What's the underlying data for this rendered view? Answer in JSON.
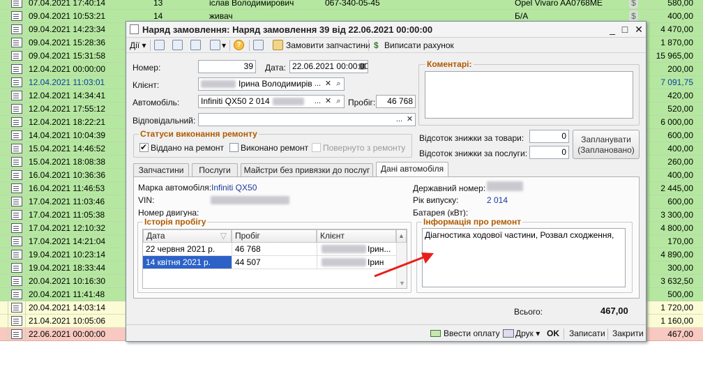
{
  "background_rows": [
    {
      "date": "07.04.2021 17:40:14",
      "sum": "580,00",
      "style": "green",
      "num": "13",
      "client": "іслав Володимирович",
      "phone": "067-340-05-45",
      "car": "Opel Vivaro  AA0768ME",
      "dollar": true
    },
    {
      "date": "09.04.2021 10:53:21",
      "sum": "400,00",
      "style": "green",
      "num": "14",
      "client": "живач",
      "phone": "",
      "car": "Б/А",
      "dollar": true
    },
    {
      "date": "09.04.2021 14:23:34",
      "sum": "4 470,00",
      "style": "green"
    },
    {
      "date": "09.04.2021 15:28:36",
      "sum": "1 870,00",
      "style": "green"
    },
    {
      "date": "09.04.2021 15:31:58",
      "sum": "15 965,00",
      "style": "green"
    },
    {
      "date": "12.04.2021 00:00:00",
      "sum": "200,00",
      "style": "green"
    },
    {
      "date": "12.04.2021 11:03:01",
      "sum": "7 091,75",
      "style": "green",
      "blue": true
    },
    {
      "date": "12.04.2021 14:34:41",
      "sum": "420,00",
      "style": "green"
    },
    {
      "date": "12.04.2021 17:55:12",
      "sum": "520,00",
      "style": "green"
    },
    {
      "date": "12.04.2021 18:22:21",
      "sum": "6 000,00",
      "style": "green"
    },
    {
      "date": "14.04.2021 10:04:39",
      "sum": "600,00",
      "style": "green"
    },
    {
      "date": "15.04.2021 14:46:52",
      "sum": "400,00",
      "style": "green"
    },
    {
      "date": "15.04.2021 18:08:38",
      "sum": "260,00",
      "style": "green"
    },
    {
      "date": "16.04.2021 10:36:36",
      "sum": "400,00",
      "style": "green"
    },
    {
      "date": "16.04.2021 11:46:53",
      "sum": "2 445,00",
      "style": "green"
    },
    {
      "date": "17.04.2021 11:03:46",
      "sum": "600,00",
      "style": "green"
    },
    {
      "date": "17.04.2021 11:05:38",
      "sum": "3 300,00",
      "style": "green"
    },
    {
      "date": "17.04.2021 12:10:32",
      "sum": "4 800,00",
      "style": "green"
    },
    {
      "date": "17.04.2021 14:21:04",
      "sum": "170,00",
      "style": "green"
    },
    {
      "date": "19.04.2021 10:23:14",
      "sum": "4 890,00",
      "style": "green"
    },
    {
      "date": "19.04.2021 18:33:44",
      "sum": "300,00",
      "style": "green"
    },
    {
      "date": "20.04.2021 10:16:30",
      "sum": "3 632,50",
      "style": "green"
    },
    {
      "date": "20.04.2021 11:41:48",
      "sum": "500,00",
      "style": "green"
    },
    {
      "date": "20.04.2021 14:03:14",
      "sum": "1 720,00",
      "style": "yellow"
    },
    {
      "date": "21.04.2021 10:05:06",
      "sum": "1 160,00",
      "style": "yellow"
    },
    {
      "date": "22.06.2021 00:00:00",
      "sum": "467,00",
      "style": "red"
    }
  ],
  "dialog": {
    "title": "Наряд замовлення: Наряд замовлення 39 від 22.06.2021 00:00:00",
    "window_buttons": [
      "_",
      "□",
      "✕"
    ],
    "toolbar": {
      "actions_label": "Дії",
      "order_parts_label": "Замовити запчастини",
      "invoice_label": "Виписати рахунок"
    },
    "form": {
      "number_label": "Номер:",
      "number_value": "39",
      "date_label": "Дата:",
      "date_value": "22.06.2021 00:00:00",
      "client_label": "Клієнт:",
      "client_value": "Ірина Володимирів",
      "car_label": "Автомобіль:",
      "car_value": "Infiniti QX50 2 014",
      "mileage_label": "Пробіг:",
      "mileage_value": "46 768",
      "responsible_label": "Відповідальний:",
      "responsible_value": "",
      "comments_label": "Коментарі:"
    },
    "statuses": {
      "legend": "Статуси виконання ремонту",
      "handed_over": "Віддано на ремонт",
      "completed": "Виконано ремонт",
      "returned": "Повернуто з ремонту"
    },
    "discounts": {
      "goods_label": "Відсоток знижки за товари:",
      "goods_value": "0",
      "services_label": "Відсоток знижки за послуги:",
      "services_value": "0"
    },
    "plan_button": {
      "line1": "Запланувати",
      "line2": "(Заплановано)"
    },
    "tabs": [
      "Запчастини",
      "Послуги",
      "Майстри без привязки до послуг",
      "Дані автомобіля"
    ],
    "car_data": {
      "brand_label": "Марка автомобіля:",
      "brand_value": "Infiniti QX50",
      "vin_label": "VIN:",
      "engine_label": "Номер двигуна:",
      "plate_label": "Державний номер:",
      "year_label": "Рік випуску:",
      "year_value": "2 014",
      "battery_label": "Батарея (кВт):"
    },
    "history": {
      "legend": "Історія пробігу",
      "columns": [
        "Дата",
        "Пробіг",
        "Клієнт"
      ],
      "rows": [
        {
          "date": "22 червня 2021 р.",
          "mileage": "46 768",
          "client": "Ірин..."
        },
        {
          "date": "14 квітня 2021 р.",
          "mileage": "44 507",
          "client": "Ірин"
        }
      ]
    },
    "repair_info": {
      "legend": "Інформація про ремонт",
      "text": "Діагностика ходової частини, Розвал сходження,"
    },
    "total": {
      "label": "Всього:",
      "value": "467,00"
    },
    "footer": {
      "pay_label": "Ввести оплату",
      "print_label": "Друк",
      "ok_label": "OK",
      "save_label": "Записати",
      "close_label": "Закрити"
    }
  }
}
